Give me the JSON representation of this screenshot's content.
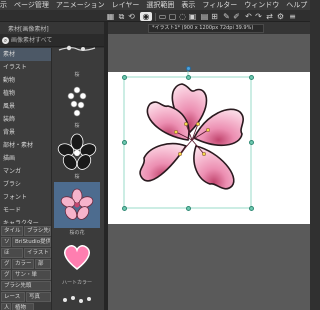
{
  "menu": [
    "示",
    "ページ管理",
    "アニメーション",
    "レイヤー",
    "選択範囲",
    "表示",
    "フィルター",
    "ウィンドウ",
    "ヘルプ"
  ],
  "panel": {
    "title": "素材[画像素材]",
    "search_label": "画像素材すべて"
  },
  "tree": [
    "素材",
    "イラスト",
    "動物",
    "植物",
    "風景",
    "装飾",
    "背景",
    "部材・素材",
    "描画",
    "マンガ",
    "ブラシ",
    "フォント",
    "モード",
    "キャラクター",
    "ーン"
  ],
  "tags": [
    "タイル",
    "ブラシ先材",
    "ソリ",
    "BriStudio提供",
    "ほ",
    "イラスト",
    "グ",
    "カラー",
    "部",
    "グ",
    "サン・単",
    "ブラシ先頭",
    "レース",
    "写真",
    "人",
    "植物"
  ],
  "thumbs": [
    "桜",
    "桜",
    "桜",
    "桜の花",
    "桜",
    "ハートカラー"
  ],
  "document": {
    "tab_label": "*イラスト1* (900 x 1200px 72dpi 39.9%)"
  },
  "colors": {
    "petal": "#f2a7c4",
    "petal_dark": "#c2466f",
    "outline": "#2a1a1f",
    "handle": "#6fc9b0"
  }
}
